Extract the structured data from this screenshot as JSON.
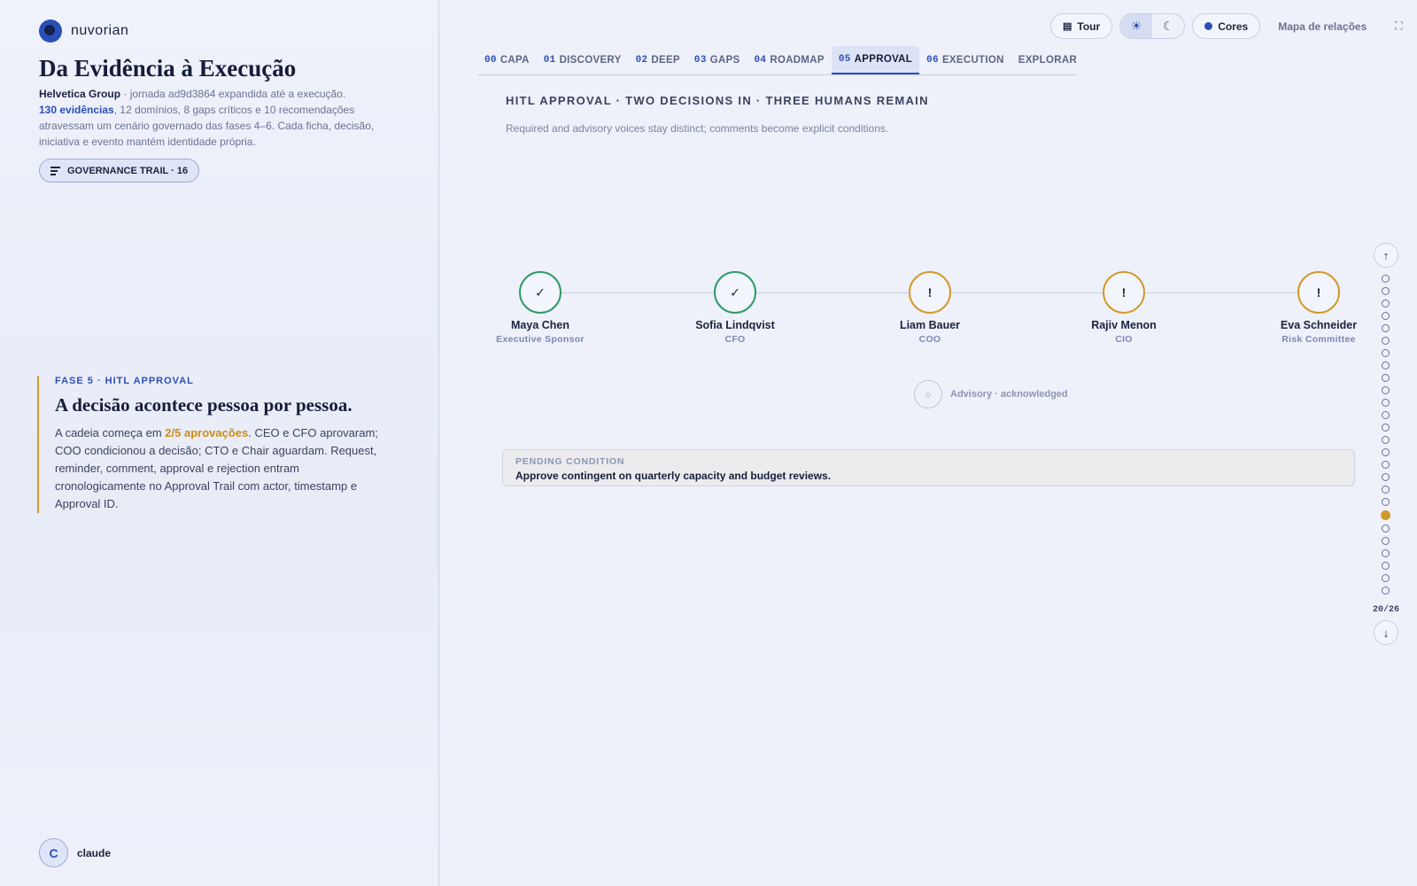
{
  "brand": {
    "name": "nuvorian"
  },
  "hero": {
    "title": "Da Evidência à Execução",
    "org": "Helvetica Group",
    "org_suffix": " · jornada ad9d3864 expandida até a execução.",
    "evidence_count": "130 evidências",
    "evidence_suffix": ", 12 domínios, 8 gaps críticos e 10 recomendações atravessam um cenário governado das fases 4–6. Cada ficha, decisão, iniciativa e evento mantém identidade própria."
  },
  "governance_button": {
    "label": "GOVERNANCE TRAIL · 16",
    "icon": "list-lines-icon"
  },
  "phase": {
    "tag": "FASE 5 · HITL APPROVAL",
    "title": "A decisão acontece pessoa por pessoa.",
    "text_prefix": "A cadeia começa em ",
    "text_highlight": "2/5 aprovações",
    "text_suffix": ". CEO e CFO aprovaram; COO condicionou a decisão; CTO e Chair aguardam. Request, reminder, comment, approval e rejection entram cronologicamente no Approval Trail com actor, timestamp e Approval ID."
  },
  "user": {
    "initial": "C",
    "name": "claude"
  },
  "top_controls": {
    "tour_label": "Tour",
    "tour_icon": "book-icon",
    "light_icon": "sun-icon",
    "dark_icon": "moon-icon",
    "colors_label": "Cores",
    "colors_accent": "#2b4fb8",
    "map_label": "Mapa de relações",
    "expand_icon": "expand-icon"
  },
  "tabs": [
    {
      "num": "00",
      "label": "CAPA"
    },
    {
      "num": "01",
      "label": "DISCOVERY"
    },
    {
      "num": "02",
      "label": "DEEP"
    },
    {
      "num": "03",
      "label": "GAPS"
    },
    {
      "num": "04",
      "label": "ROADMAP"
    },
    {
      "num": "05",
      "label": "APPROVAL",
      "active": true
    },
    {
      "num": "06",
      "label": "EXECUTION"
    },
    {
      "num": "",
      "label": "EXPLORAR"
    }
  ],
  "main": {
    "title": "HITL APPROVAL · TWO DECISIONS IN · THREE HUMANS REMAIN",
    "subtitle": "Required and advisory voices stay distinct; comments become explicit conditions."
  },
  "approvers": [
    {
      "name": "Maya Chen",
      "role": "Executive Sponsor",
      "status": "approved",
      "glyph": "✓",
      "color": "#2f9a68"
    },
    {
      "name": "Sofia Lindqvist",
      "role": "CFO",
      "status": "approved",
      "glyph": "✓",
      "color": "#2f9a68"
    },
    {
      "name": "Liam Bauer",
      "role": "COO",
      "status": "pending",
      "glyph": "!",
      "color": "#d29a2a"
    },
    {
      "name": "Rajiv Menon",
      "role": "CIO",
      "status": "pending",
      "glyph": "!",
      "color": "#d29a2a"
    },
    {
      "name": "Eva Schneider",
      "role": "Risk Committee",
      "status": "pending",
      "glyph": "!",
      "color": "#d29a2a"
    }
  ],
  "advisory": {
    "label": "Advisory · acknowledged",
    "glyph": "◇"
  },
  "pending_condition": {
    "label": "PENDING CONDITION",
    "text": "Approve contingent on quarterly capacity and budget reviews."
  },
  "rail": {
    "up_icon": "arrow-up-icon",
    "down_icon": "arrow-down-icon",
    "total": 26,
    "current": 20,
    "counter": "20/26"
  }
}
